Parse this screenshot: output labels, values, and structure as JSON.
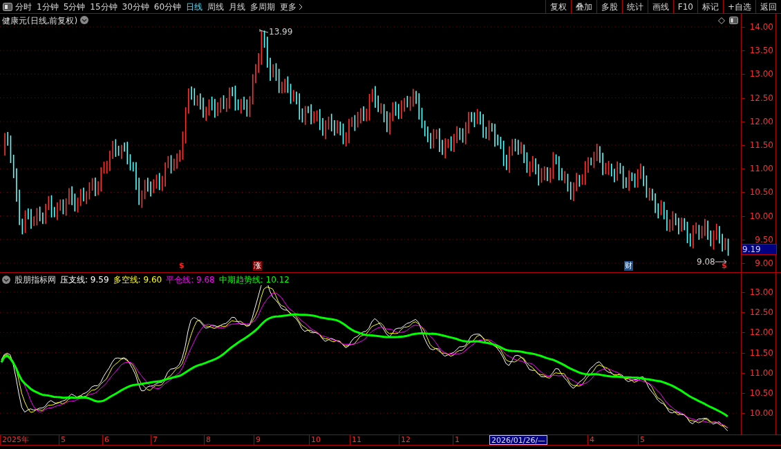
{
  "toolbar": {
    "periods": [
      {
        "label": "分时",
        "selected": false
      },
      {
        "label": "1分钟",
        "selected": false
      },
      {
        "label": "5分钟",
        "selected": false
      },
      {
        "label": "15分钟",
        "selected": false
      },
      {
        "label": "30分钟",
        "selected": false
      },
      {
        "label": "60分钟",
        "selected": false
      },
      {
        "label": "日线",
        "selected": true
      },
      {
        "label": "周线",
        "selected": false
      },
      {
        "label": "月线",
        "selected": false
      },
      {
        "label": "多周期",
        "selected": false
      },
      {
        "label": "更多",
        "selected": false
      }
    ],
    "actions": [
      "复权",
      "叠加",
      "多股",
      "统计",
      "画线",
      "F10",
      "标记",
      "+自选",
      "返回"
    ]
  },
  "main_chart": {
    "title": "健康元(日线,前复权)",
    "price_axis": [
      "14.00",
      "13.50",
      "13.00",
      "12.50",
      "12.00",
      "11.50",
      "11.00",
      "10.50",
      "10.00",
      "9.50",
      "9.00"
    ],
    "current_price": "9.19",
    "high_label": "13.99",
    "low_label": "9.08",
    "markers": [
      {
        "text": "$",
        "kind": "dollar"
      },
      {
        "text": "涨",
        "kind": "limit"
      },
      {
        "text": "财",
        "kind": "finance"
      },
      {
        "text": "$",
        "kind": "dollar"
      }
    ]
  },
  "indicator": {
    "name": "股朋指标网",
    "values": [
      {
        "label": "压支线:",
        "value": "9.59",
        "color": "#ffffff"
      },
      {
        "label": "多空线:",
        "value": "9.60",
        "color": "#ffff00"
      },
      {
        "label": "平仓线:",
        "value": "9.68",
        "color": "#ff00ff"
      },
      {
        "label": "中期趋势线:",
        "value": "10.12",
        "color": "#00ff00"
      }
    ],
    "axis": [
      "13.00",
      "12.50",
      "12.00",
      "11.50",
      "11.00",
      "10.50",
      "10.00"
    ]
  },
  "time_axis": [
    {
      "text": "2025年",
      "selected": false
    },
    {
      "text": "5",
      "selected": false
    },
    {
      "text": "6",
      "selected": false
    },
    {
      "text": "7",
      "selected": false
    },
    {
      "text": "8",
      "selected": false
    },
    {
      "text": "9",
      "selected": false
    },
    {
      "text": "10",
      "selected": false
    },
    {
      "text": "11",
      "selected": false
    },
    {
      "text": "12",
      "selected": false
    },
    {
      "text": "1",
      "selected": false
    },
    {
      "text": "2026/01/26/—",
      "selected": true
    },
    {
      "text": "4",
      "selected": false
    },
    {
      "text": "5",
      "selected": false
    }
  ]
}
